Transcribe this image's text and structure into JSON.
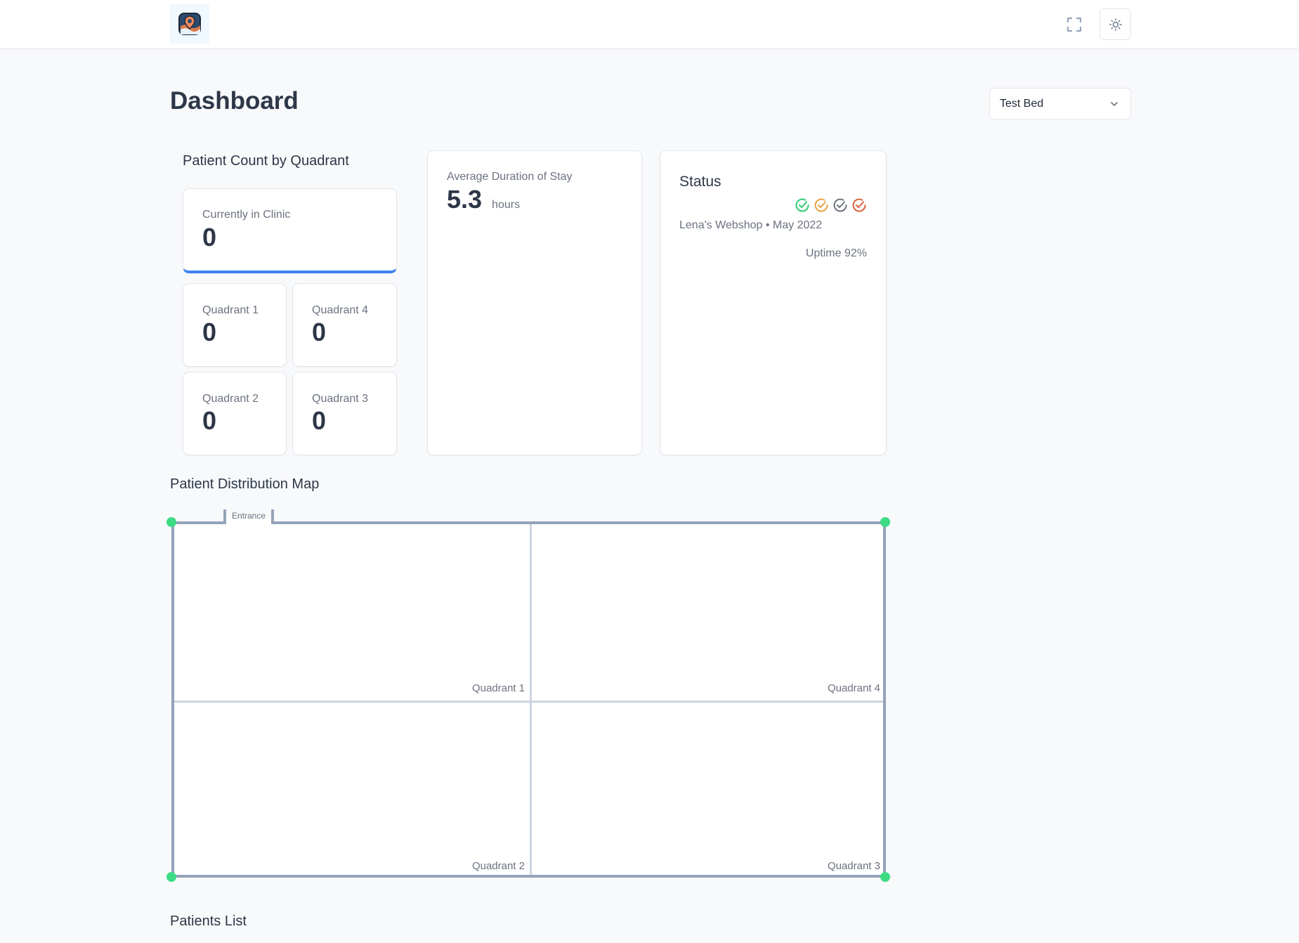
{
  "header": {
    "logo_icon": "map-pin-logo-icon",
    "fullscreen_icon": "fullscreen-icon",
    "theme_icon": "sun-icon"
  },
  "page": {
    "title": "Dashboard",
    "selector": {
      "selected": "Test Bed",
      "icon": "chevron-down-icon"
    }
  },
  "patient_count": {
    "title": "Patient Count by Quadrant",
    "total": {
      "label": "Currently in Clinic",
      "value": "0"
    },
    "quadrants": [
      {
        "label": "Quadrant 1",
        "value": "0"
      },
      {
        "label": "Quadrant 4",
        "value": "0"
      },
      {
        "label": "Quadrant 2",
        "value": "0"
      },
      {
        "label": "Quadrant 3",
        "value": "0"
      }
    ]
  },
  "avg_stay": {
    "label": "Average Duration of Stay",
    "value": "5.3",
    "unit": "hours"
  },
  "status": {
    "title": "Status",
    "checks": [
      {
        "icon": "check-circle-icon",
        "color": "#2ecc71"
      },
      {
        "icon": "check-circle-icon",
        "color": "#e8a33d"
      },
      {
        "icon": "check-circle-icon",
        "color": "#6b7280"
      },
      {
        "icon": "check-circle-icon",
        "color": "#d9623b"
      }
    ],
    "subtitle": "Lena's Webshop • May 2022",
    "uptime": "Uptime 92%"
  },
  "map": {
    "title": "Patient Distribution Map",
    "entrance_label": "Entrance",
    "quadrant_labels": [
      "Quadrant 1",
      "Quadrant 4",
      "Quadrant 2",
      "Quadrant 3"
    ],
    "accent_color": "#3ddc84"
  },
  "patients_list": {
    "title": "Patients List"
  }
}
